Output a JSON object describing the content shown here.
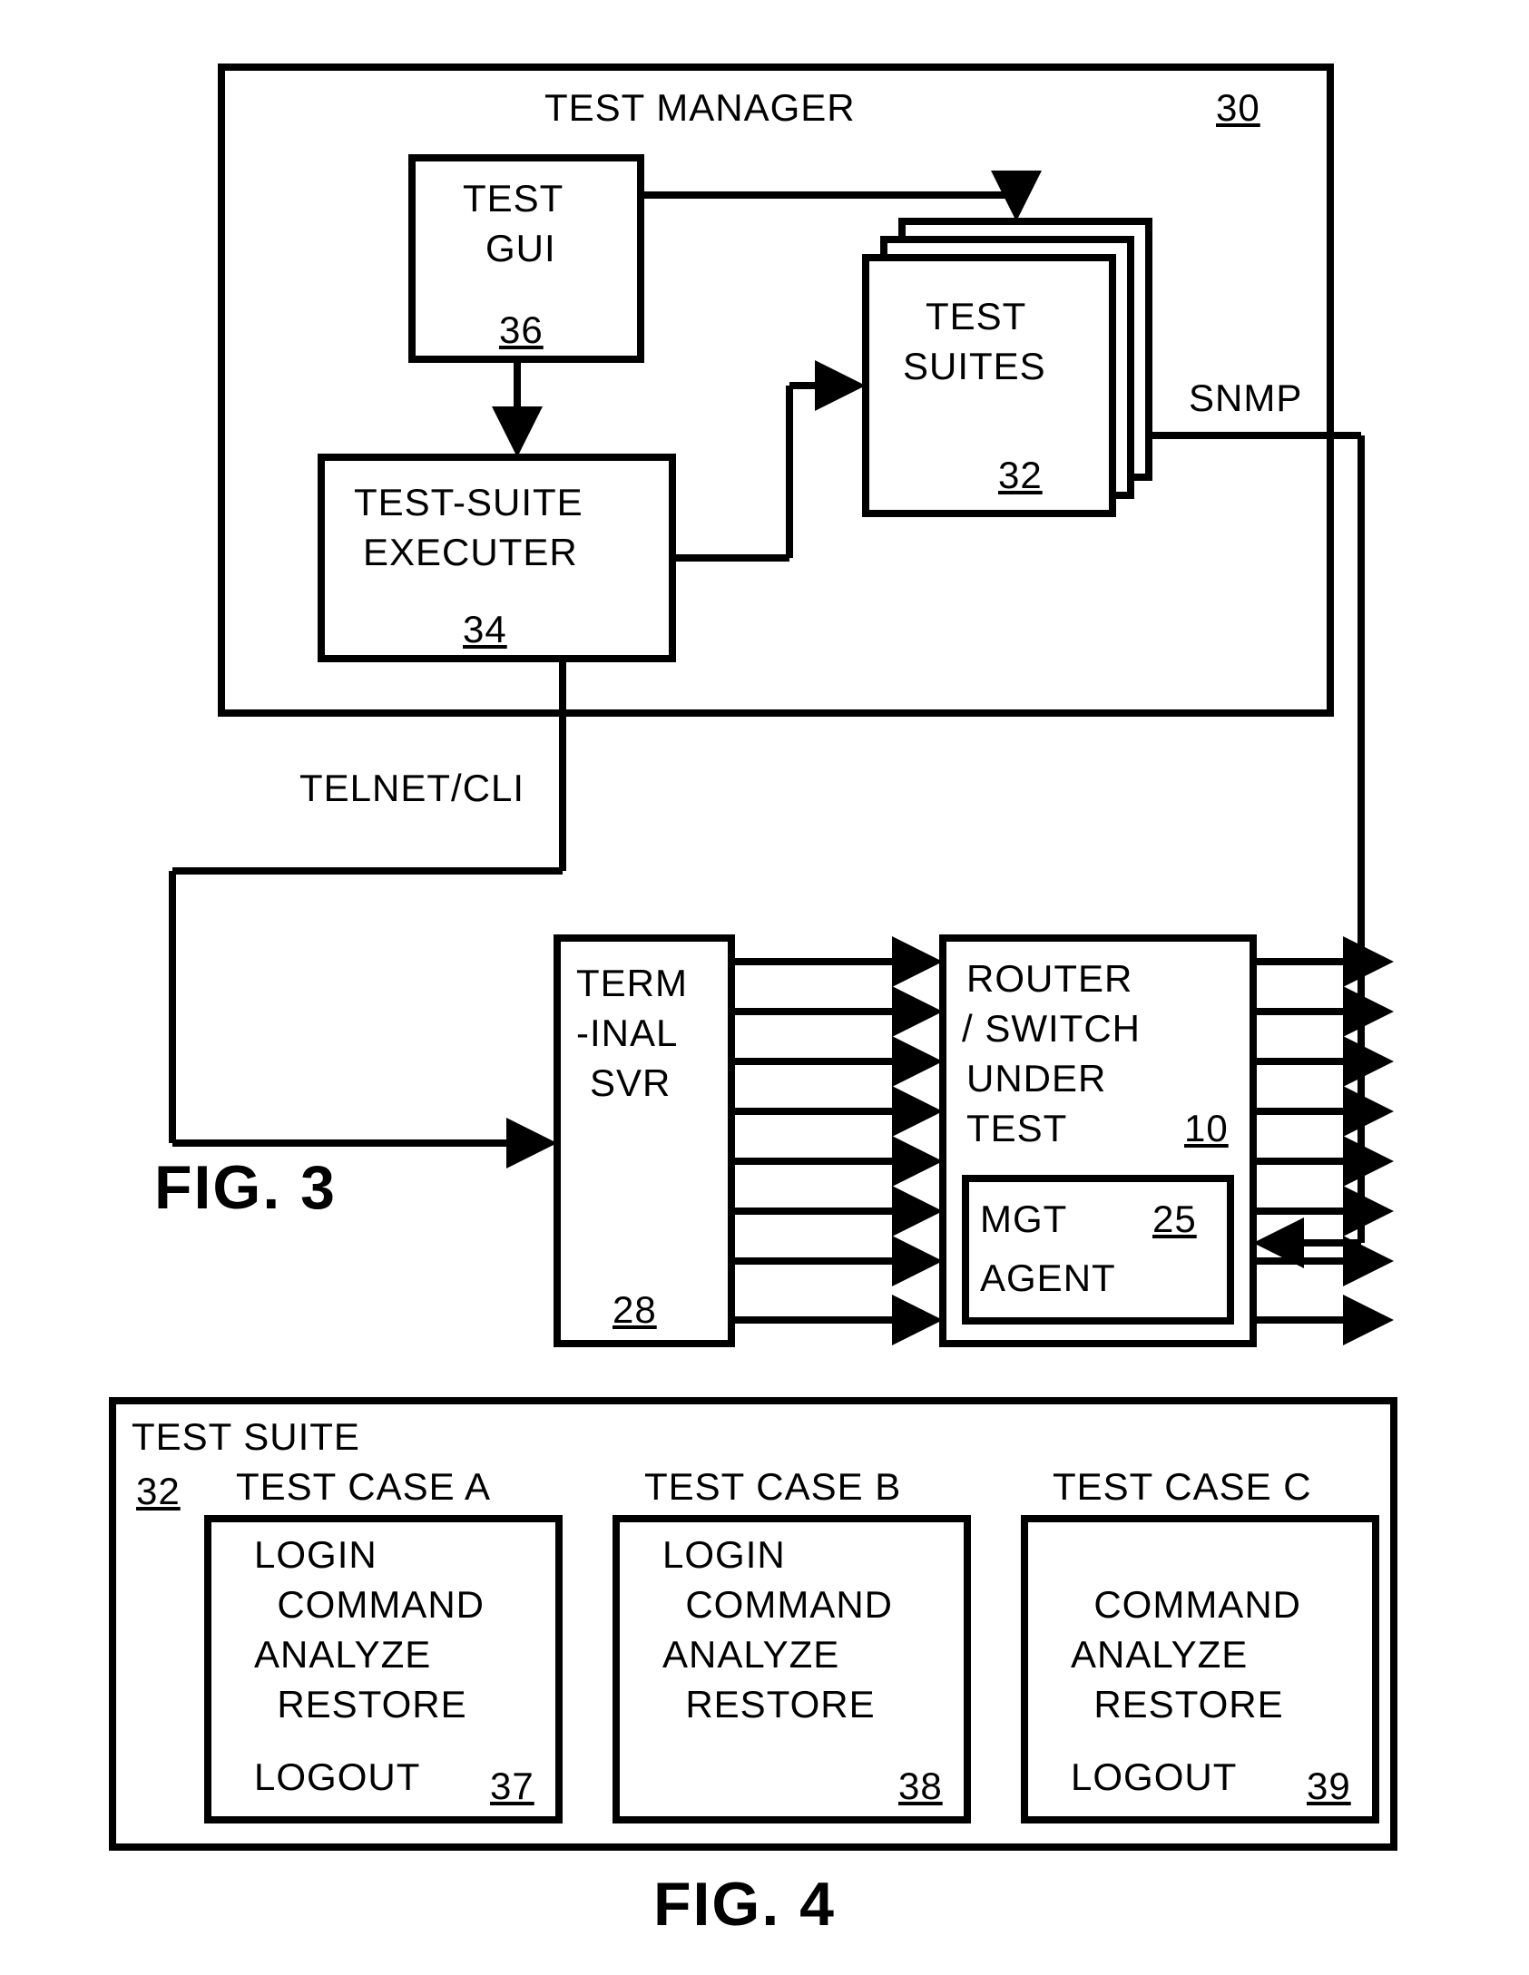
{
  "fig3": {
    "testManager": {
      "title": "TEST MANAGER",
      "num": "30"
    },
    "testGui": {
      "line1": "TEST",
      "line2": "GUI",
      "num": "36"
    },
    "testSuiteExecuter": {
      "line1": "TEST-SUITE",
      "line2": "EXECUTER",
      "num": "34"
    },
    "testSuites": {
      "line1": "TEST",
      "line2": "SUITES",
      "num": "32"
    },
    "snmp": "SNMP",
    "telnet": "TELNET/CLI",
    "terminalSvr": {
      "line1": "TERM",
      "line2": "-INAL",
      "line3": "SVR",
      "num": "28"
    },
    "router": {
      "line1": "ROUTER",
      "line2": "/ SWITCH",
      "line3": "UNDER",
      "line4": "TEST",
      "num": "10"
    },
    "mgtAgent": {
      "line1": "MGT",
      "line2": "AGENT",
      "num": "25"
    },
    "figLabel": "FIG. 3"
  },
  "fig4": {
    "title": "TEST SUITE",
    "num": "32",
    "caseA": {
      "title": "TEST CASE A",
      "lines": [
        "LOGIN",
        "  COMMAND",
        "ANALYZE",
        "  RESTORE",
        "LOGOUT"
      ],
      "num": "37"
    },
    "caseB": {
      "title": "TEST CASE B",
      "lines": [
        "LOGIN",
        "  COMMAND",
        "ANALYZE",
        "  RESTORE",
        ""
      ],
      "num": "38"
    },
    "caseC": {
      "title": "TEST CASE C",
      "lines": [
        "",
        "  COMMAND",
        "ANALYZE",
        "  RESTORE",
        "LOGOUT"
      ],
      "num": "39"
    },
    "figLabel": "FIG. 4"
  }
}
